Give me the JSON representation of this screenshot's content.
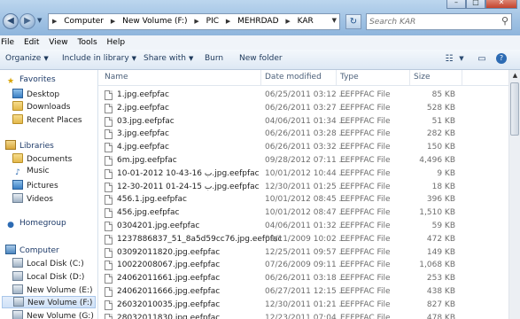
{
  "window": {
    "minimize": "–",
    "maximize": "□",
    "close": "✕"
  },
  "address": {
    "crumbs": [
      "Computer",
      "New Volume (F:)",
      "PIC",
      "MEHRDAD",
      "KAR"
    ]
  },
  "search": {
    "placeholder": "Search KAR"
  },
  "menu": [
    "File",
    "Edit",
    "View",
    "Tools",
    "Help"
  ],
  "toolbar": {
    "organize": "Organize",
    "include": "Include in library",
    "share": "Share with",
    "burn": "Burn",
    "new_folder": "New folder"
  },
  "sidebar": {
    "favorites": "Favorites",
    "desktop": "Desktop",
    "downloads": "Downloads",
    "recent": "Recent Places",
    "libraries": "Libraries",
    "documents": "Documents",
    "music": "Music",
    "pictures": "Pictures",
    "videos": "Videos",
    "homegroup": "Homegroup",
    "computer": "Computer",
    "drives": [
      "Local Disk (C:)",
      "Local Disk (D:)",
      "New Volume (E:)",
      "New Volume (F:)",
      "New Volume (G:)"
    ]
  },
  "columns": {
    "name": "Name",
    "date": "Date modified",
    "type": "Type",
    "size": "Size"
  },
  "files": [
    {
      "name": "1.jpg.eefpfac",
      "date": "06/25/2011 03:12 ...",
      "type": "EEFPFAC File",
      "size": "85 KB"
    },
    {
      "name": "2.jpg.eefpfac",
      "date": "06/26/2011 03:27 ...",
      "type": "EEFPFAC File",
      "size": "528 KB"
    },
    {
      "name": "03.jpg.eefpfac",
      "date": "04/06/2011 01:34 ...",
      "type": "EEFPFAC File",
      "size": "51 KB"
    },
    {
      "name": "3.jpg.eefpfac",
      "date": "06/26/2011 03:28 ...",
      "type": "EEFPFAC File",
      "size": "282 KB"
    },
    {
      "name": "4.jpg.eefpfac",
      "date": "06/26/2011 03:32 ...",
      "type": "EEFPFAC File",
      "size": "150 KB"
    },
    {
      "name": "6m.jpg.eefpfac",
      "date": "09/28/2012 07:11 ...",
      "type": "EEFPFAC File",
      "size": "4,496 KB"
    },
    {
      "name": "10-01-2012 10-43-16 ب.jpg.eefpfac",
      "date": "10/01/2012 10:44 ...",
      "type": "EEFPFAC File",
      "size": "9 KB"
    },
    {
      "name": "12-30-2011 01-24-15 ب.jpg.eefpfac",
      "date": "12/30/2011 01:25 ...",
      "type": "EEFPFAC File",
      "size": "18 KB"
    },
    {
      "name": "456.1.jpg.eefpfac",
      "date": "10/01/2012 08:45 ...",
      "type": "EEFPFAC File",
      "size": "396 KB"
    },
    {
      "name": "456.jpg.eefpfac",
      "date": "10/01/2012 08:47 ...",
      "type": "EEFPFAC File",
      "size": "1,510 KB"
    },
    {
      "name": "0304201.jpg.eefpfac",
      "date": "04/06/2011 01:32 ...",
      "type": "EEFPFAC File",
      "size": "59 KB"
    },
    {
      "name": "1237886837_51_8a5d59cc76.jpg.eefpfac",
      "date": "09/11/2009 10:02 ...",
      "type": "EEFPFAC File",
      "size": "472 KB"
    },
    {
      "name": "03092011820.jpg.eefpfac",
      "date": "12/25/2011 09:57 ...",
      "type": "EEFPFAC File",
      "size": "149 KB"
    },
    {
      "name": "10022008067.jpg.eefpfac",
      "date": "07/26/2009 09:11 ...",
      "type": "EEFPFAC File",
      "size": "1,068 KB"
    },
    {
      "name": "24062011661.jpg.eefpfac",
      "date": "06/26/2011 03:18 ...",
      "type": "EEFPFAC File",
      "size": "253 KB"
    },
    {
      "name": "24062011666.jpg.eefpfac",
      "date": "06/27/2011 12:15 ...",
      "type": "EEFPFAC File",
      "size": "438 KB"
    },
    {
      "name": "26032010035.jpg.eefpfac",
      "date": "12/30/2011 01:21 ...",
      "type": "EEFPFAC File",
      "size": "827 KB"
    },
    {
      "name": "28032011830.jpg.eefpfac",
      "date": "12/23/2011 07:04 ...",
      "type": "EEFPFAC File",
      "size": "478 KB"
    }
  ]
}
